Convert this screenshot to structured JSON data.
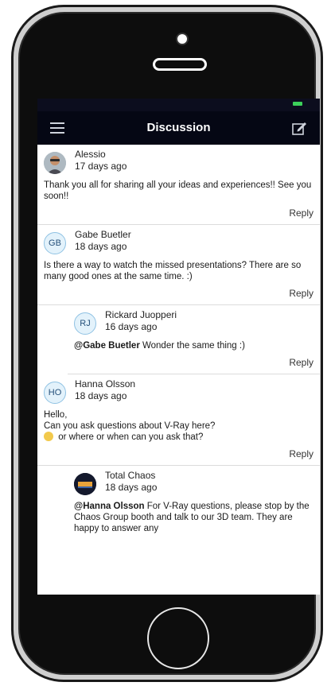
{
  "nav": {
    "title": "Discussion",
    "menu_icon": "hamburger-menu-icon",
    "compose_icon": "compose-icon"
  },
  "colors": {
    "nav_background": "#050714",
    "battery": "#3cd05a",
    "avatar_border": "#8fc2e3"
  },
  "posts": [
    {
      "author": "Alessio",
      "time": "17 days ago",
      "avatar_type": "photo",
      "body": "Thank you all for sharing all your ideas and experiences!! See you soon!!",
      "reply_label": "Reply"
    },
    {
      "author": "Gabe Buetler",
      "time": "18 days ago",
      "avatar_initials": "GB",
      "body": "Is there a way to watch the missed presentations? There are so many good ones at the same time. :)",
      "reply_label": "Reply"
    },
    {
      "author": "Rickard Juopperi",
      "time": "16 days ago",
      "avatar_initials": "RJ",
      "mention": "@Gabe Buetler",
      "body": " Wonder the same thing :)",
      "reply_label": "Reply"
    },
    {
      "author": "Hanna Olsson",
      "time": "18 days ago",
      "avatar_initials": "HO",
      "body_line1": "Hello,",
      "body_line2": "Can you ask questions about V-Ray here?",
      "body_line3": " or where or when can you ask that?",
      "reply_label": "Reply"
    },
    {
      "author": "Total Chaos",
      "time": "18 days ago",
      "avatar_type": "logo",
      "mention": "@Hanna Olsson",
      "body": " For V-Ray questions, please stop by the Chaos Group booth and talk to our 3D team. They are happy to answer any"
    }
  ]
}
